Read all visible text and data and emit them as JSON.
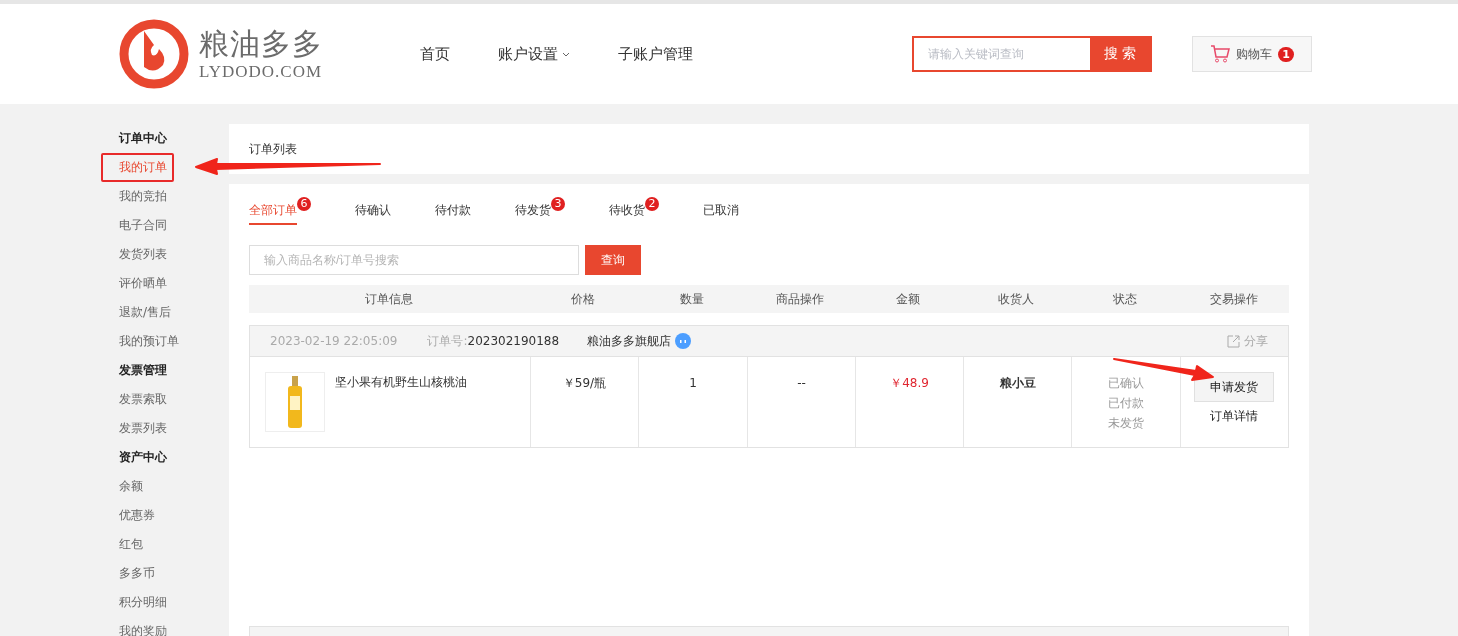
{
  "header": {
    "logo": {
      "name": "粮油多多",
      "domain": "LYDODO.COM"
    },
    "nav": [
      {
        "label": "首页",
        "dropdown": false
      },
      {
        "label": "账户设置",
        "dropdown": true
      },
      {
        "label": "子账户管理",
        "dropdown": false
      }
    ],
    "search": {
      "placeholder": "请输入关键词查询",
      "button": "搜 索"
    },
    "cart": {
      "label": "购物车",
      "count": "1"
    }
  },
  "sidebar": [
    {
      "title": "订单中心",
      "items": [
        {
          "label": "我的订单",
          "selected": true
        },
        {
          "label": "我的竞拍",
          "selected": false
        },
        {
          "label": "电子合同",
          "selected": false
        },
        {
          "label": "发货列表",
          "selected": false
        },
        {
          "label": "评价晒单",
          "selected": false
        },
        {
          "label": "退款/售后",
          "selected": false
        },
        {
          "label": "我的预订单",
          "selected": false
        }
      ]
    },
    {
      "title": "发票管理",
      "items": [
        {
          "label": "发票索取",
          "selected": false
        },
        {
          "label": "发票列表",
          "selected": false
        }
      ]
    },
    {
      "title": "资产中心",
      "items": [
        {
          "label": "余额",
          "selected": false
        },
        {
          "label": "优惠券",
          "selected": false
        },
        {
          "label": "红包",
          "selected": false
        },
        {
          "label": "多多币",
          "selected": false
        },
        {
          "label": "积分明细",
          "selected": false
        },
        {
          "label": "我的奖励",
          "selected": false
        }
      ]
    }
  ],
  "breadcrumb": "订单列表",
  "tabs": [
    {
      "label": "全部订单",
      "count": "6",
      "selected": true
    },
    {
      "label": "待确认",
      "selected": false
    },
    {
      "label": "待付款",
      "selected": false
    },
    {
      "label": "待发货",
      "count": "3",
      "selected": false
    },
    {
      "label": "待收货",
      "count": "2",
      "selected": false
    },
    {
      "label": "已取消",
      "selected": false
    }
  ],
  "order_search": {
    "placeholder": "输入商品名称/订单号搜索",
    "button": "查询"
  },
  "table": {
    "columns": [
      "订单信息",
      "价格",
      "数量",
      "商品操作",
      "金额",
      "收货人",
      "状态",
      "交易操作"
    ],
    "orders": [
      {
        "time": "2023-02-19 22:05:09",
        "number_label": "订单号:",
        "number": "202302190188",
        "shop": "粮油多多旗舰店",
        "share": "分享",
        "product": "坚小果有机野生山核桃油",
        "price": "￥59/瓶",
        "quantity": "1",
        "product_action": "--",
        "amount": "￥48.9",
        "receiver": "粮小豆",
        "status": [
          "已确认",
          "已付款",
          "未发货"
        ],
        "action_button": "申请发货",
        "action_link": "订单详情"
      }
    ]
  },
  "annotations": [
    {
      "kind": "arrow"
    },
    {
      "kind": "arrow"
    }
  ]
}
